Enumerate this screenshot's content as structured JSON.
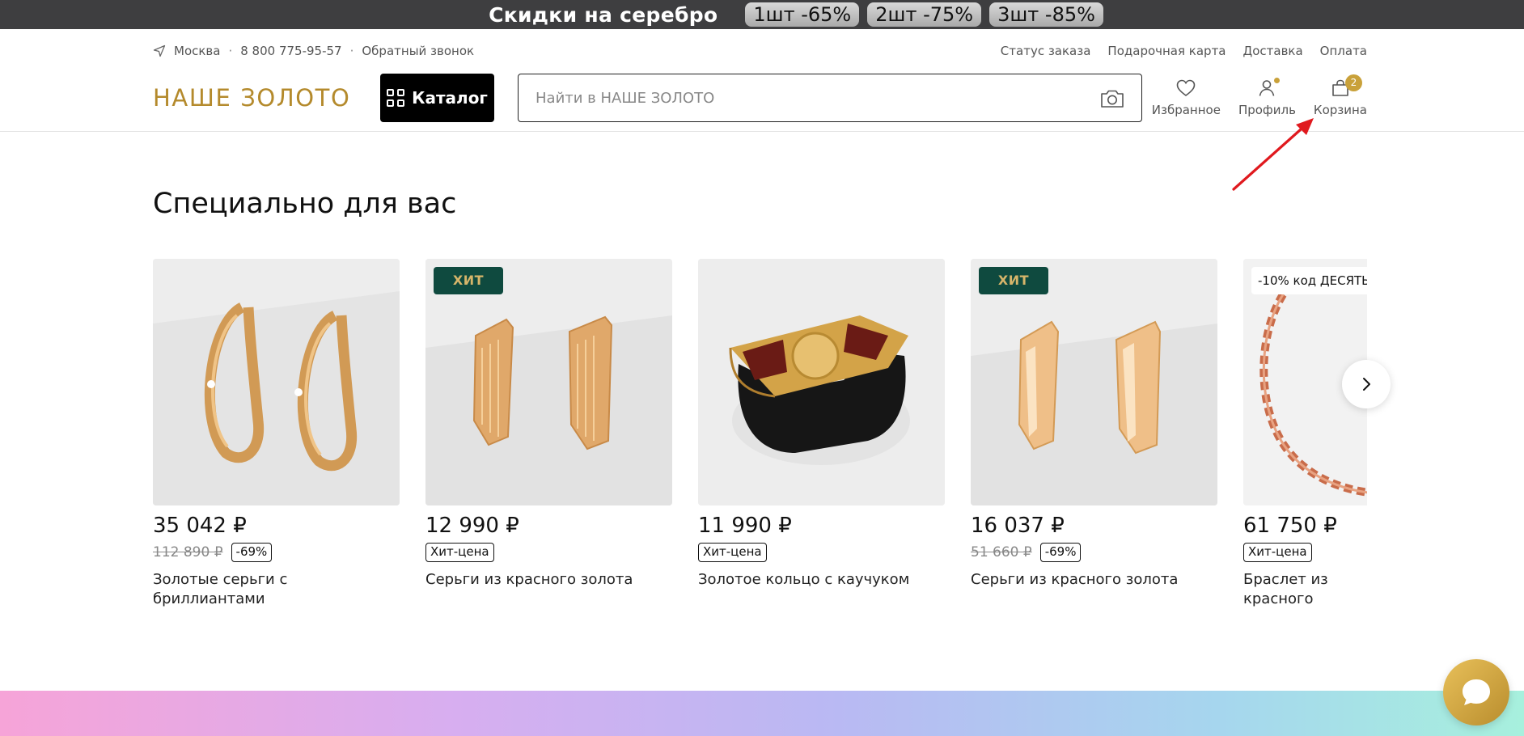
{
  "promo": {
    "title": "Скидки на серебро",
    "chips": [
      "1шт -65%",
      "2шт -75%",
      "3шт -85%"
    ]
  },
  "info": {
    "city": "Москва",
    "phone": "8 800 775-95-57",
    "callback": "Обратный звонок",
    "links": [
      "Статус заказа",
      "Подарочная карта",
      "Доставка",
      "Оплата"
    ]
  },
  "header": {
    "logo": "НАШЕ ЗОЛОТО",
    "catalog_label": "Каталог",
    "search_placeholder": "Найти в НАШЕ ЗОЛОТО",
    "favorites_label": "Избранное",
    "profile_label": "Профиль",
    "cart_label": "Корзина",
    "cart_count": "2"
  },
  "section": {
    "title": "Специально для вас"
  },
  "products": [
    {
      "price": "35 042 ₽",
      "old_price": "112 890 ₽",
      "discount": "-69%",
      "name": "Золотые серьги с бриллиантами"
    },
    {
      "badge": "ХИТ",
      "price": "12 990 ₽",
      "label": "Хит-цена",
      "name": "Серьги из красного золота"
    },
    {
      "price": "11 990 ₽",
      "label": "Хит-цена",
      "name": "Золотое кольцо с каучуком"
    },
    {
      "badge": "ХИТ",
      "price": "16 037 ₽",
      "old_price": "51 660 ₽",
      "discount": "-69%",
      "name": "Серьги из красного золота"
    },
    {
      "promo_tag": "-10% код ДЕСЯТЬ",
      "price": "61 750 ₽",
      "label": "Хит-цена",
      "name": "Браслет из красного золота с фианитами"
    }
  ],
  "colors": {
    "brand_gold": "#b48a2c",
    "hit_green": "#0f4a3f",
    "promo_bg": "#3e3e40"
  }
}
